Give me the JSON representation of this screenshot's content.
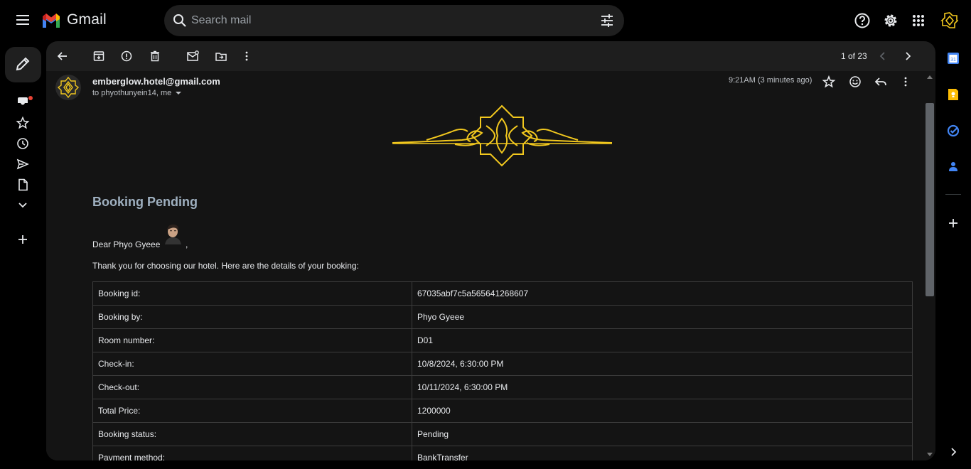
{
  "app": {
    "name": "Gmail",
    "search_placeholder": "Search mail"
  },
  "toolbar": {
    "page_count": "1 of 23"
  },
  "message": {
    "sender": "emberglow.hotel@gmail.com",
    "recipients": "to phyothunyein14, me",
    "timestamp": "9:21AM (3 minutes ago)",
    "title": "Booking Pending",
    "greeting": "Dear Phyo Gyeee",
    "greeting_suffix": ",",
    "intro": "Thank you for choosing our hotel. Here are the details of your booking:",
    "details": [
      {
        "label": "Booking id:",
        "value": "67035abf7c5a565641268607"
      },
      {
        "label": "Booking by:",
        "value": "Phyo Gyeee"
      },
      {
        "label": "Room number:",
        "value": "D01"
      },
      {
        "label": "Check-in:",
        "value": "10/8/2024, 6:30:00 PM"
      },
      {
        "label": "Check-out:",
        "value": "10/11/2024, 6:30:00 PM"
      },
      {
        "label": "Total Price:",
        "value": "1200000"
      },
      {
        "label": "Booking status:",
        "value": "Pending"
      },
      {
        "label": "Payment method:",
        "value": "BankTransfer"
      }
    ]
  },
  "colors": {
    "background": "#000000",
    "panel": "#1e1e1e",
    "message_bg": "#141414",
    "title": "#9fb0c0",
    "gold": "#f2c81e"
  },
  "icons": {
    "menu": "menu-icon",
    "search": "search-icon",
    "filter": "tune-icon",
    "help": "help-icon",
    "settings": "gear-icon",
    "apps": "apps-grid-icon"
  }
}
